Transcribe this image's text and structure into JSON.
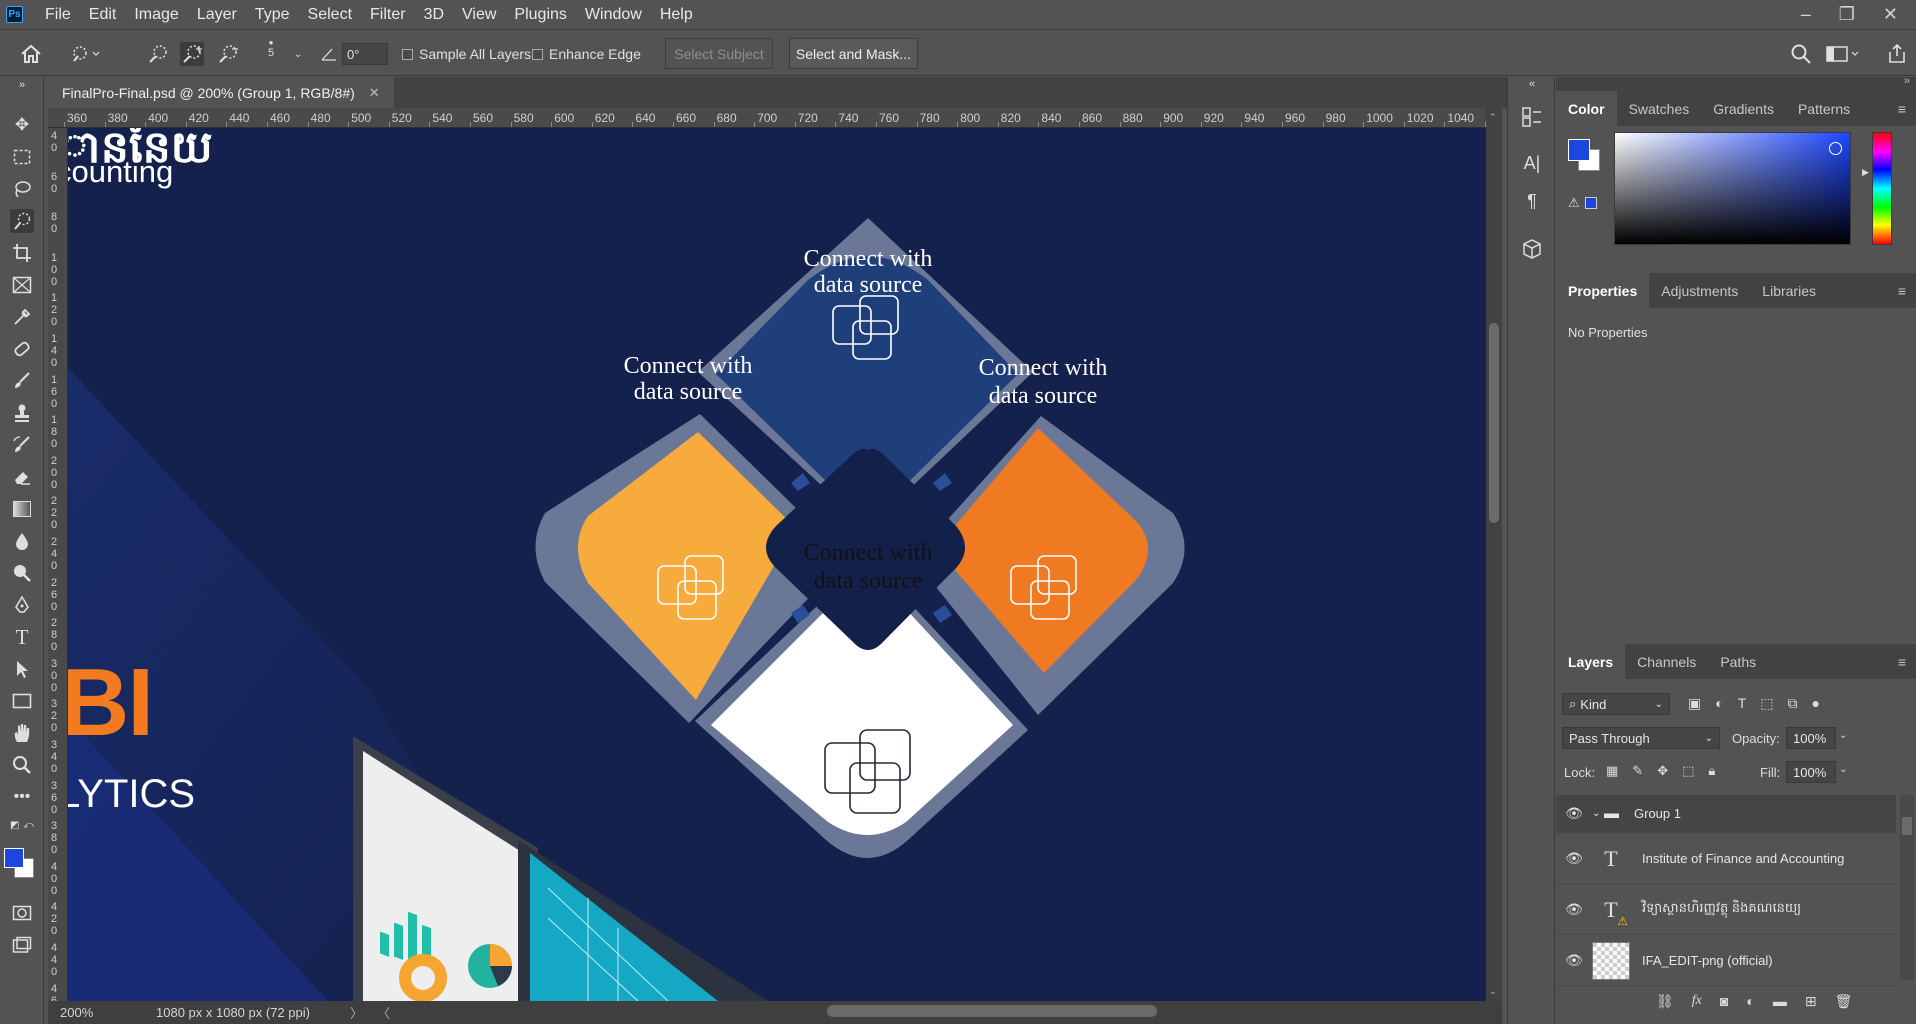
{
  "app": {
    "logo": "Ps",
    "window_controls": [
      "–",
      "❐",
      "✕"
    ]
  },
  "menu": [
    "File",
    "Edit",
    "Image",
    "Layer",
    "Type",
    "Select",
    "Filter",
    "3D",
    "View",
    "Plugins",
    "Window",
    "Help"
  ],
  "options": {
    "brush_size": "5",
    "angle": "0°",
    "sample_all_layers": "Sample All Layers",
    "enhance_edge": "Enhance Edge",
    "select_subject": "Select Subject",
    "select_and_mask": "Select and Mask..."
  },
  "document": {
    "tab_title": "FinalPro-Final.psd @ 200% (Group 1, RGB/8#)",
    "zoom": "200%",
    "doc_info": "1080 px x 1080 px (72 ppi)"
  },
  "rulers": {
    "top": [
      "360",
      "380",
      "400",
      "420",
      "440",
      "460",
      "480",
      "500",
      "520",
      "540",
      "560",
      "580",
      "600",
      "620",
      "640",
      "660",
      "680",
      "700",
      "720",
      "740",
      "760",
      "780",
      "800",
      "820",
      "840",
      "860",
      "880",
      "900",
      "920",
      "940",
      "960",
      "980",
      "1000",
      "1020",
      "1040",
      "1"
    ],
    "left": [
      "40",
      "60",
      "80",
      "100",
      "120",
      "140",
      "160",
      "180",
      "200",
      "220",
      "240",
      "260",
      "280",
      "300",
      "320",
      "340",
      "360",
      "380",
      "400",
      "420",
      "440",
      "460"
    ]
  },
  "canvas": {
    "khmer_fragment": "ាននៃយ",
    "accounting_fragment": "counting",
    "bi_text": "BI",
    "analytics_fragment": "LYTICS",
    "diamond_top": [
      "Connect with",
      "data source"
    ],
    "diamond_left": [
      "Connect with",
      "data source"
    ],
    "diamond_right": [
      "Connect with",
      "data source"
    ],
    "diamond_bottom": [
      "Connect with",
      "data source"
    ],
    "colors": {
      "navy": "#13204a",
      "blue": "#1e3f7a",
      "yellow": "#f7ab3d",
      "orange": "#f07a22",
      "white": "#ffffff",
      "frame": "#6b7797"
    }
  },
  "color_panel": {
    "tabs": [
      "Color",
      "Swatches",
      "Gradients",
      "Patterns"
    ],
    "foreground": "#1d46e0",
    "background": "#ffffff"
  },
  "properties_panel": {
    "tabs": [
      "Properties",
      "Adjustments",
      "Libraries"
    ],
    "message": "No Properties"
  },
  "layers_panel": {
    "tabs": [
      "Layers",
      "Channels",
      "Paths"
    ],
    "filter_kind": "Kind",
    "blend_mode": "Pass Through",
    "opacity_label": "Opacity:",
    "opacity": "100%",
    "lock_label": "Lock:",
    "fill_label": "Fill:",
    "fill": "100%",
    "layers": [
      {
        "name": "Group 1",
        "type": "group"
      },
      {
        "name": "Institute of Finance and Accounting",
        "type": "text"
      },
      {
        "name": "វិទ្យាស្ថានហិរញ្ញវត្ថុ និងគណនេយ្យ",
        "type": "text-warning"
      },
      {
        "name": "IFA_EDIT-png (official)",
        "type": "image"
      }
    ]
  }
}
